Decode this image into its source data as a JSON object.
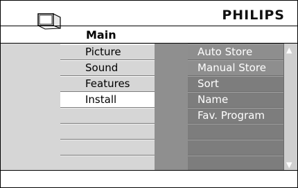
{
  "header": {
    "brand": "PHILIPS",
    "menu_title": "Main",
    "tv_icon": "tv-icon"
  },
  "left_menu": {
    "items": [
      {
        "label": "Picture",
        "selected": false
      },
      {
        "label": "Sound",
        "selected": false
      },
      {
        "label": "Features",
        "selected": false
      },
      {
        "label": "Install",
        "selected": true
      }
    ]
  },
  "submenu": {
    "items": [
      {
        "label": "Auto Store",
        "highlighted": true
      },
      {
        "label": "Manual Store",
        "highlighted": true
      },
      {
        "label": "Sort",
        "highlighted": false
      },
      {
        "label": "Name",
        "highlighted": false
      },
      {
        "label": "Fav. Program",
        "highlighted": false
      }
    ]
  },
  "scroll": {
    "up_icon": "▲",
    "down_icon": "▼"
  },
  "colors": {
    "left_panel": "#d6d6d6",
    "submenu_panel": "#7d7d7d",
    "selected_item": "#ffffff",
    "submenu_text": "#ffffff"
  }
}
